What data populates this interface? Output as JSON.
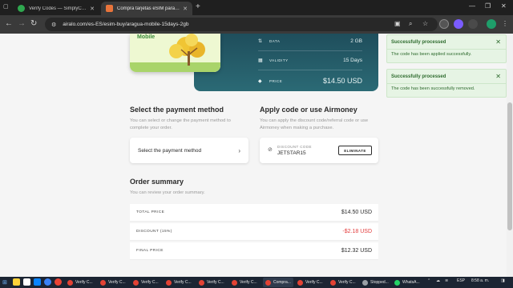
{
  "browser": {
    "tabs": [
      {
        "title": "Verify Codes — SimplyCodes",
        "active": false
      },
      {
        "title": "Compra tarjetas eSIM para viaj...",
        "active": true
      }
    ],
    "url": "airalo.com/es-ES/esim-buy/aragua-mobile-15days-2gb"
  },
  "esim": {
    "card_label": "Mobile",
    "details": [
      {
        "icon": "data-icon",
        "label": "DATA",
        "value": "2 GB"
      },
      {
        "icon": "calendar-icon",
        "label": "VALIDITY",
        "value": "15 Days"
      },
      {
        "icon": "price-tag-icon",
        "label": "PRICE",
        "value": "$14.50 USD"
      }
    ]
  },
  "payment": {
    "title": "Select the payment method",
    "description": "You can select or change the payment method to complete your order.",
    "button_label": "Select the payment method"
  },
  "promo": {
    "title": "Apply code or use Airmoney",
    "description": "You can apply the discount code/referral code or use Airmoney when making a purchase.",
    "code_label": "DISCOUNT CODE",
    "code_value": "JETSTAR15",
    "eliminate_label": "ELIMINATE"
  },
  "summary": {
    "title": "Order summary",
    "description": "You can review your order summary.",
    "rows": [
      {
        "label": "TOTAL PRICE",
        "value": "$14.50 USD",
        "negative": false
      },
      {
        "label": "DISCOUNT (15%)",
        "value": "-$2.18 USD",
        "negative": true
      },
      {
        "label": "FINAL PRICE",
        "value": "$12.32 USD",
        "negative": false
      }
    ]
  },
  "toasts": [
    {
      "title": "Successfully processed",
      "message": "The code has been applied successfully."
    },
    {
      "title": "Successfully processed",
      "message": "The code has been successfully removed."
    }
  ],
  "taskbar": {
    "items": [
      "Verify C...",
      "Verify C...",
      "Verify C...",
      "Verify C...",
      "Verify C...",
      "Verify C...",
      "Compra...",
      "Verify C...",
      "Verify C...",
      "Stopped...",
      "WhatsA..."
    ],
    "lang": "ESP",
    "time": "8:58 a. m."
  },
  "colors": {
    "detail_card": "#1f4e5c",
    "toast_bg": "#e6f4e4",
    "discount_red": "#e33b3b"
  }
}
